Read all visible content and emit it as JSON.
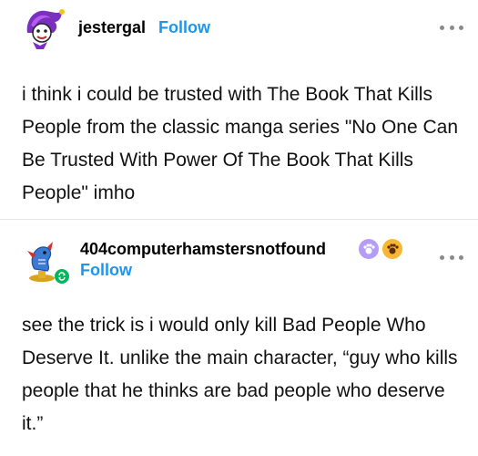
{
  "post1": {
    "username": "jestergal",
    "follow_label": "Follow",
    "body": "i think i could be trusted with The Book That Kills People from the classic manga series \"No One Can Be Trusted With Power Of The Book That Kills People\" imho",
    "avatar_icon": "jester-avatar"
  },
  "post2": {
    "username": "404computerhamstersnotfound",
    "follow_label": "Follow",
    "body": "see the trick is i would only kill Bad People Who Deserve It. unlike the main character, “guy who kills people that he thinks are bad people who deserve it.”",
    "avatar_icon": "seahorse-trophy-avatar",
    "badges": [
      "rainbow-paw-badge",
      "orange-paw-badge"
    ],
    "reblog_icon": "reblog-sync-icon"
  },
  "colors": {
    "follow": "#1a96f0",
    "divider": "#e6e6e6",
    "more_dots": "#8a8a8a"
  }
}
